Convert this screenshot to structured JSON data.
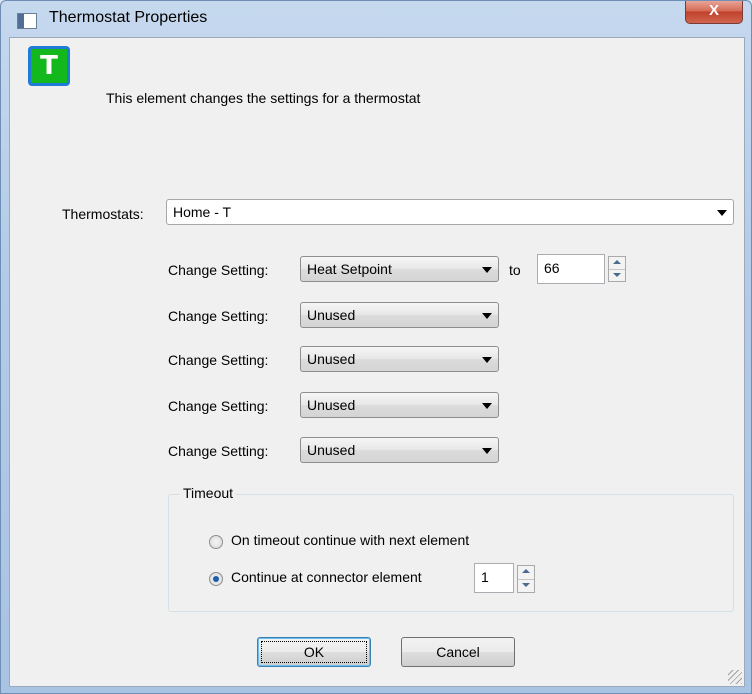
{
  "window": {
    "title": "Thermostat Properties",
    "close_label": "X"
  },
  "header": {
    "logo_letter": "T",
    "description": "This element changes the settings for a thermostat"
  },
  "thermostats": {
    "label": "Thermostats:",
    "selected": "Home - T"
  },
  "settings": [
    {
      "label": "Change Setting:",
      "selected": "Heat Setpoint",
      "to_label": "to",
      "value": "66"
    },
    {
      "label": "Change Setting:",
      "selected": "Unused"
    },
    {
      "label": "Change Setting:",
      "selected": "Unused"
    },
    {
      "label": "Change Setting:",
      "selected": "Unused"
    },
    {
      "label": "Change Setting:",
      "selected": "Unused"
    }
  ],
  "timeout": {
    "title": "Timeout",
    "option1": "On timeout continue with next element",
    "option2": "Continue at connector element",
    "selected": "option2",
    "connector_value": "1"
  },
  "buttons": {
    "ok": "OK",
    "cancel": "Cancel"
  }
}
